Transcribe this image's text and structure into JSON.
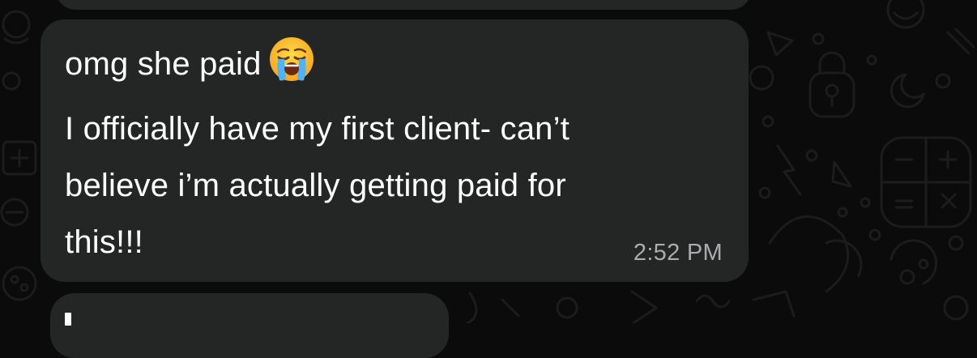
{
  "colors": {
    "background": "#0b0b0b",
    "bubble": "#242626",
    "message_text": "#ffffff",
    "timestamp_text": "#a9abad"
  },
  "message": {
    "line1": "omg she paid",
    "emoji": "loudly-crying-face-emoji",
    "line2": "I officially have my first client- can’t",
    "line3": "believe i’m actually getting paid for",
    "line4": "this!!!",
    "time": "2:52 PM"
  }
}
